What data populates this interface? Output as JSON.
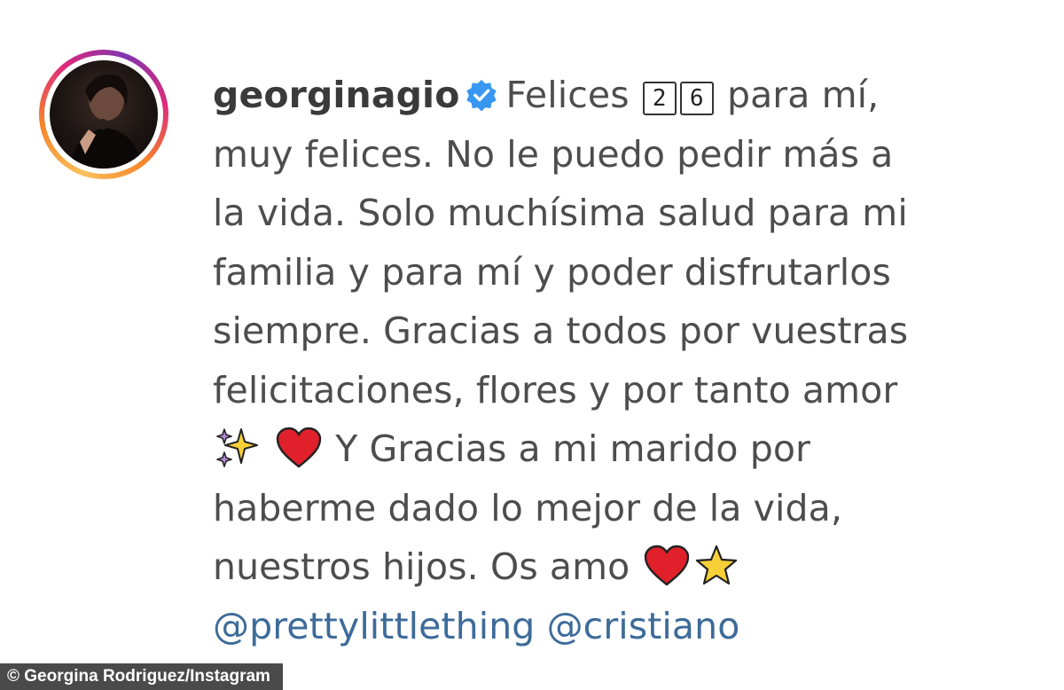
{
  "post": {
    "username": "georginagio",
    "verified": true,
    "age_digits": [
      "2",
      "6"
    ],
    "line1_before": "Felices",
    "line1_after": "para mí,",
    "lines_middle": [
      "muy felices. No le puedo pedir más a",
      "la vida. Solo muchísima salud para mi",
      "familia y para mí y poder disfrutarlos",
      "siempre. Gracias a todos por vuestras",
      "felicitaciones, flores y por tanto amor"
    ],
    "line7_text": "Y Gracias a mi marido por",
    "line8_text": "haberme dado lo mejor de la vida,",
    "line9_text": "nuestros hijos. Os amo",
    "mentions": [
      "@prettylittlething",
      "@cristiano"
    ]
  },
  "icons": {
    "verified": "verified-badge-icon",
    "sparkles": "sparkles-emoji",
    "heart": "red-heart-emoji",
    "star": "star-emoji"
  },
  "colors": {
    "text": "#4d4d4d",
    "mention": "#3d6b99",
    "verified_blue": "#3897f0",
    "heart_red": "#e0202b",
    "star_yellow": "#f7d038",
    "credit_bg": "#4a4a4a"
  },
  "credit": {
    "text": "© Georgina Rodriguez/Instagram"
  }
}
